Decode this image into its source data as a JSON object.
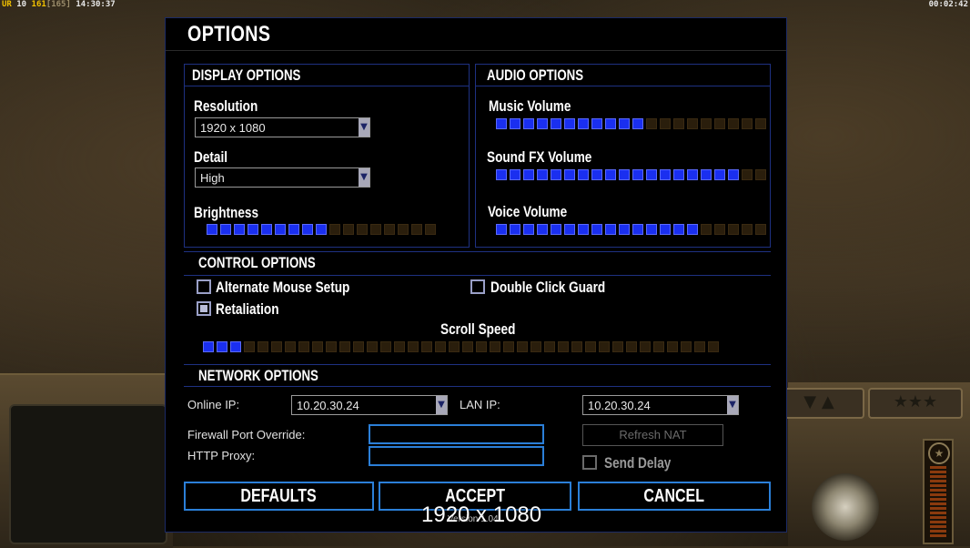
{
  "hud": {
    "ur": "UR",
    "num1": "10",
    "num2": "161",
    "num3": "[165]",
    "time": "14:30:37",
    "elapsed": "00:02:42"
  },
  "dialog": {
    "title": "OPTIONS",
    "version": "Version 1.04",
    "overlay_resolution": "1920 x 1080"
  },
  "display": {
    "title": "DISPLAY OPTIONS",
    "resolution_label": "Resolution",
    "resolution_value": "1920 x 1080",
    "detail_label": "Detail",
    "detail_value": "High",
    "brightness_label": "Brightness",
    "brightness": {
      "filled": 9,
      "total": 17
    }
  },
  "audio": {
    "title": "AUDIO OPTIONS",
    "music_label": "Music Volume",
    "music": {
      "filled": 11,
      "total": 20
    },
    "sfx_label": "Sound FX Volume",
    "sfx": {
      "filled": 18,
      "total": 20
    },
    "voice_label": "Voice Volume",
    "voice": {
      "filled": 15,
      "total": 20
    }
  },
  "control": {
    "title": "CONTROL OPTIONS",
    "alt_mouse_label": "Alternate Mouse Setup",
    "alt_mouse_checked": false,
    "double_click_label": "Double Click Guard",
    "double_click_checked": false,
    "retaliation_label": "Retaliation",
    "retaliation_checked": true,
    "scroll_label": "Scroll Speed",
    "scroll": {
      "filled": 3,
      "total": 38
    }
  },
  "network": {
    "title": "NETWORK OPTIONS",
    "online_ip_label": "Online IP:",
    "online_ip_value": "10.20.30.24",
    "lan_ip_label": "LAN IP:",
    "lan_ip_value": "10.20.30.24",
    "firewall_label": "Firewall Port Override:",
    "firewall_value": "",
    "proxy_label": "HTTP Proxy:",
    "proxy_value": "",
    "refresh_nat_label": "Refresh NAT",
    "send_delay_label": "Send Delay",
    "send_delay_checked": false
  },
  "buttons": {
    "defaults": "DEFAULTS",
    "accept": "ACCEPT",
    "cancel": "CANCEL"
  },
  "colors": {
    "slider_on": "#1a2ff0",
    "slider_off": "#2a1e0c",
    "frame_blue": "#1e3182",
    "button_border": "#2b7fd8"
  }
}
